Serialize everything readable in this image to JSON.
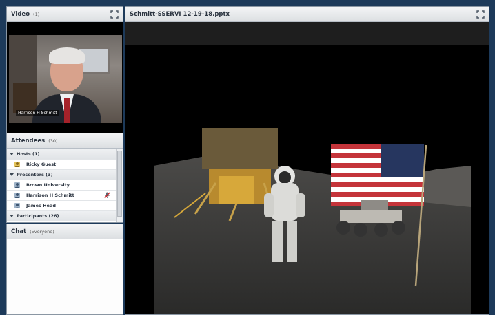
{
  "video": {
    "title": "Video",
    "count": "(1)",
    "speaker_label": "Harrison H Schmitt"
  },
  "share": {
    "title": "Schmitt-SSERVI 12-19-18.pptx"
  },
  "attendees": {
    "title": "Attendees",
    "count": "(30)",
    "hosts_label": "Hosts (1)",
    "hosts": [
      {
        "name": "Ricky Guest"
      }
    ],
    "presenters_label": "Presenters (3)",
    "presenters": [
      {
        "name": "Brown University"
      },
      {
        "name": "Harrison H Schmitt"
      },
      {
        "name": "James Head"
      }
    ],
    "participants_label": "Participants (26)"
  },
  "chat": {
    "title": "Chat",
    "scope": "(Everyone)"
  },
  "colors": {
    "frame": "#1d3a5a",
    "pod_header": "#dcdfe2",
    "slide_bg": "#000000"
  }
}
